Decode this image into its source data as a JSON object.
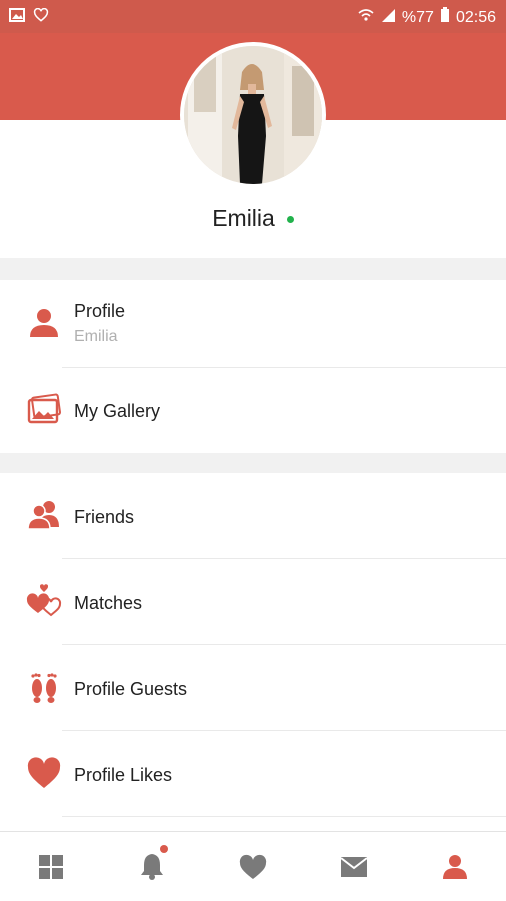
{
  "statusbar": {
    "battery": "%77",
    "time": "02:56",
    "icons": [
      "image-icon",
      "heart-outline-icon",
      "wifi-x-icon",
      "signal-icon",
      "battery-icon"
    ]
  },
  "profile": {
    "name": "Emilia",
    "status_color": "#22b24c"
  },
  "menu": {
    "group1": [
      {
        "label": "Profile",
        "sub": "Emilia",
        "icon": "person-icon"
      },
      {
        "label": "My Gallery",
        "icon": "gallery-icon"
      }
    ],
    "group2": [
      {
        "label": "Friends",
        "icon": "friends-icon"
      },
      {
        "label": "Matches",
        "icon": "matches-icon"
      },
      {
        "label": "Profile Guests",
        "icon": "footprints-icon"
      },
      {
        "label": "Profile Likes",
        "icon": "heart-icon"
      }
    ]
  },
  "bottom_nav": {
    "items": [
      "grid-icon",
      "bell-icon",
      "heart-icon",
      "mail-icon",
      "person-icon"
    ],
    "active": "person-icon"
  },
  "colors": {
    "accent": "#d95a4c",
    "icon_gray": "#7a7a7a",
    "online": "#22b24c"
  }
}
